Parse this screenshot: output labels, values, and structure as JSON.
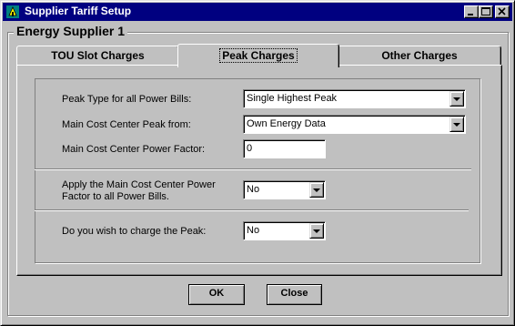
{
  "window": {
    "title": "Supplier Tariff Setup",
    "titlebar_color": "#000080"
  },
  "group": {
    "title": "Energy Supplier 1"
  },
  "tabs": [
    {
      "label": "TOU Slot Charges",
      "active": false
    },
    {
      "label": "Peak Charges",
      "active": true
    },
    {
      "label": "Other Charges",
      "active": false
    }
  ],
  "form": {
    "peak_type": {
      "label": "Peak Type for all Power Bills:",
      "value": "Single Highest Peak"
    },
    "main_cost_peak": {
      "label": "Main Cost Center Peak from:",
      "value": "Own Energy Data"
    },
    "power_factor": {
      "label": "Main Cost Center Power Factor:",
      "value": "0"
    },
    "apply_pf": {
      "label": "Apply the Main Cost Center Power Factor to all Power Bills.",
      "value": "No"
    },
    "charge_peak": {
      "label": "Do you wish to charge the Peak:",
      "value": "No"
    }
  },
  "buttons": {
    "ok": "OK",
    "close": "Close"
  }
}
